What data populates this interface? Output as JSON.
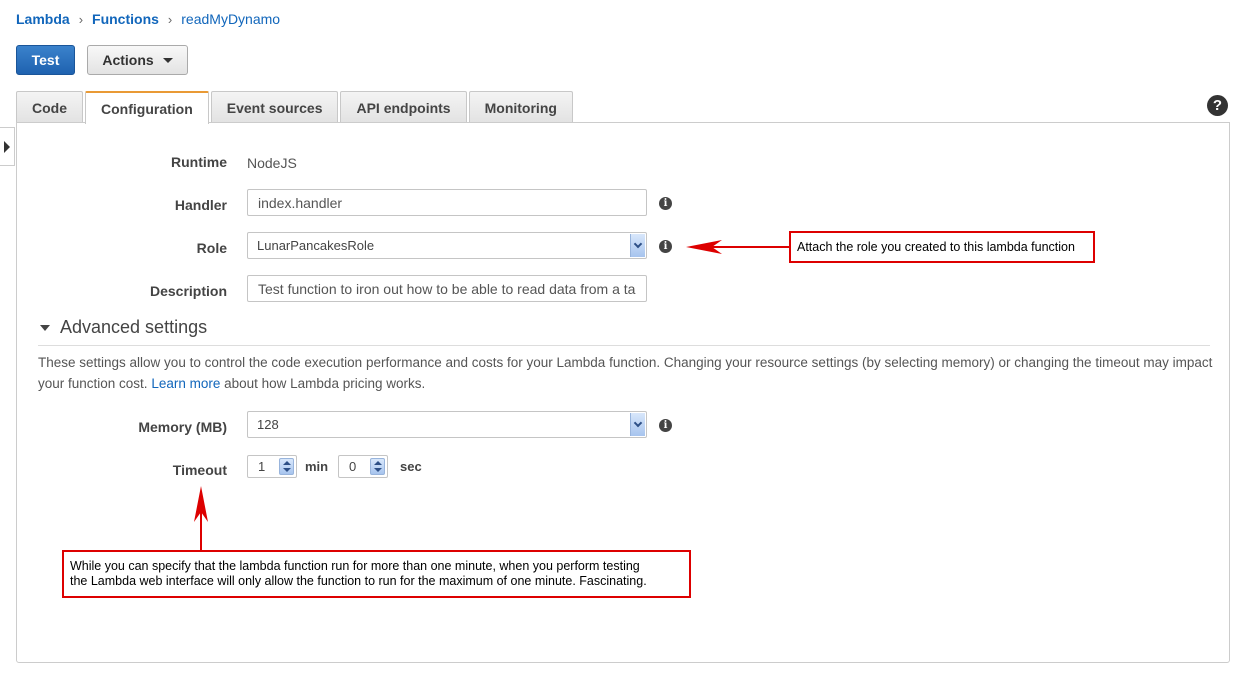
{
  "breadcrumb": {
    "items": [
      "Lambda",
      "Functions"
    ],
    "current": "readMyDynamo",
    "separator": "›"
  },
  "toolbar": {
    "test_label": "Test",
    "actions_label": "Actions"
  },
  "tabs": [
    {
      "label": "Code",
      "active": false
    },
    {
      "label": "Configuration",
      "active": true
    },
    {
      "label": "Event sources",
      "active": false
    },
    {
      "label": "API endpoints",
      "active": false
    },
    {
      "label": "Monitoring",
      "active": false
    }
  ],
  "help_glyph": "?",
  "config": {
    "runtime_label": "Runtime",
    "runtime_value": "NodeJS",
    "handler_label": "Handler",
    "handler_value": "index.handler",
    "role_label": "Role",
    "role_value": "LunarPancakesRole",
    "description_label": "Description",
    "description_value": "Test function to iron out how to be able to read data from a ta"
  },
  "advanced": {
    "title": "Advanced settings",
    "desc_text": "These settings allow you to control the code execution performance and costs for your Lambda function. Changing your resource settings (by selecting memory) or changing the timeout may impact your function cost. ",
    "learn_more": "Learn more",
    "desc_suffix": " about how Lambda pricing works.",
    "memory_label": "Memory (MB)",
    "memory_value": "128",
    "timeout_label": "Timeout",
    "timeout_min": "1",
    "min_unit": "min",
    "timeout_sec": "0",
    "sec_unit": "sec"
  },
  "annotations": {
    "role_note": "Attach the role you created to this lambda function",
    "timeout_note_line1": "While you can specify that the lambda function run for more than one minute, when you perform testing",
    "timeout_note_line2": "the Lambda web interface will only allow the function to run for the maximum of one minute.  Fascinating.",
    "color": "#dd0000"
  },
  "colors": {
    "link": "#1166bb",
    "primary_button": "#2a6fbf",
    "active_tab_accent": "#e99a35"
  },
  "info_glyph": "i"
}
